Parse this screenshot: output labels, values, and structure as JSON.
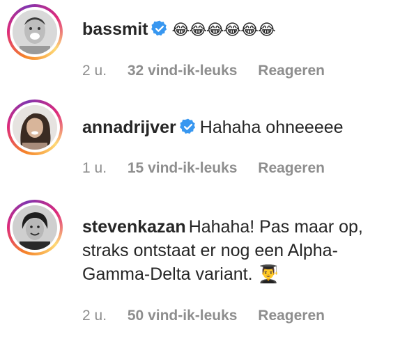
{
  "comments": [
    {
      "username": "bassmit",
      "verified": true,
      "text": "😂😂😂😂😂😂",
      "time": "2 u.",
      "likes": "32 vind-ik-leuks",
      "reply": "Reageren"
    },
    {
      "username": "annadrijver",
      "verified": true,
      "text": "Hahaha ohneeeee",
      "time": "1 u.",
      "likes": "15 vind-ik-leuks",
      "reply": "Reageren"
    },
    {
      "username": "stevenkazan",
      "verified": false,
      "text": "Hahaha! Pas maar op, straks ontstaat er nog een Alpha-Gamma-Delta variant. 👨‍🎓",
      "time": "2 u.",
      "likes": "50 vind-ik-leuks",
      "reply": "Reageren"
    }
  ],
  "colors": {
    "verified_badge": "#3897f0",
    "meta_text": "#8e8e8e",
    "primary_text": "#262626"
  }
}
